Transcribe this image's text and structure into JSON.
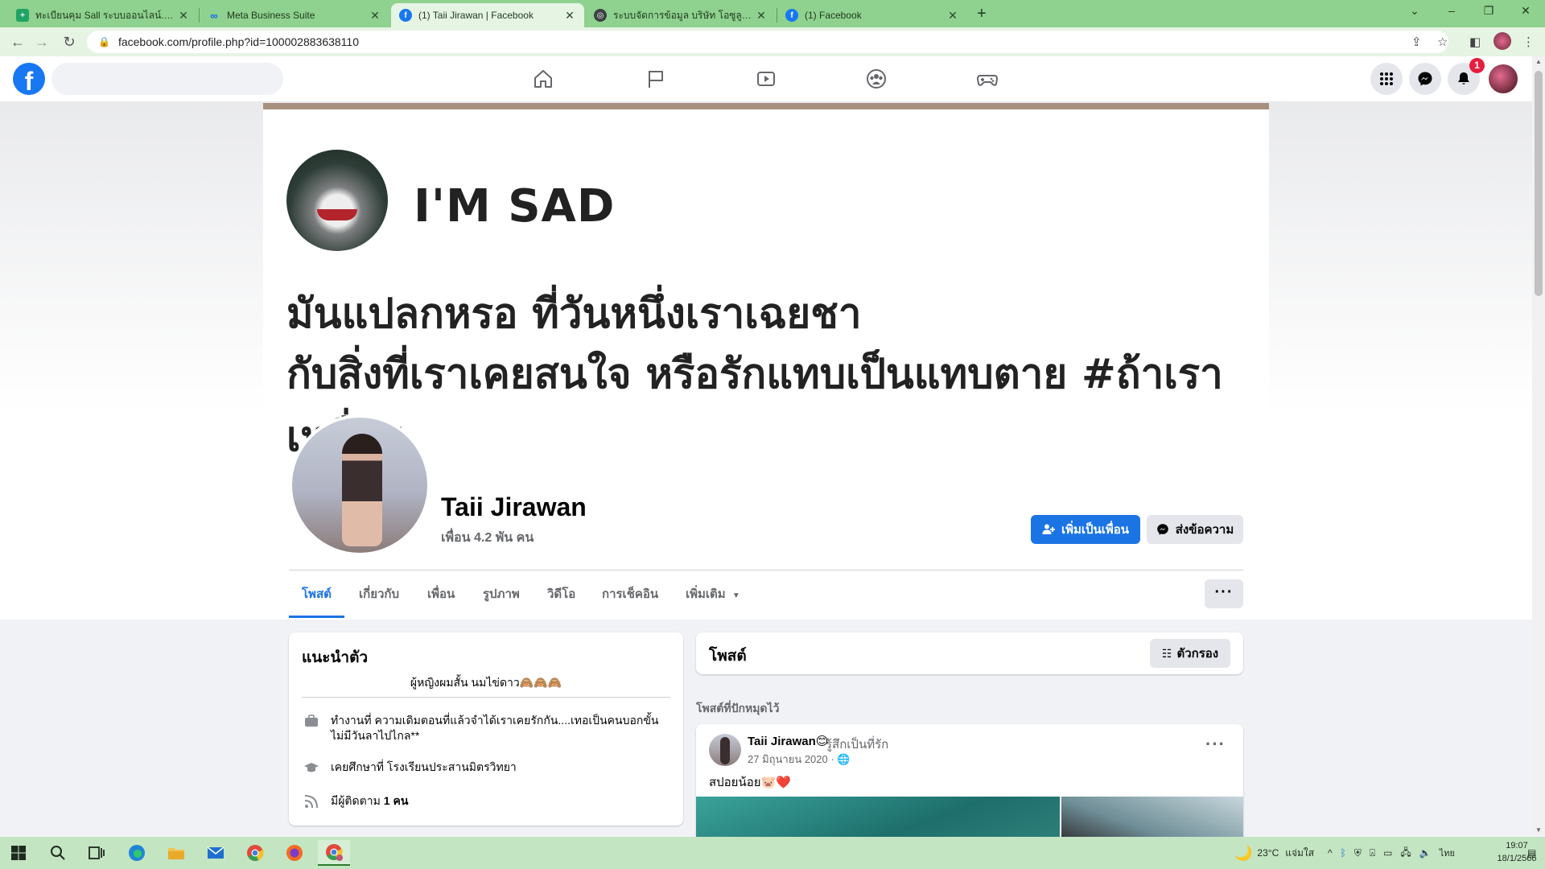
{
  "browser": {
    "tabs": [
      {
        "title": "ทะเบียนคุม Sall ระบบออนไลน์.xlsx - G",
        "favicon": "sheets-icon",
        "active": false
      },
      {
        "title": "Meta Business Suite",
        "favicon": "meta-icon",
        "active": false
      },
      {
        "title": "(1) Taii Jirawan | Facebook",
        "favicon": "facebook-icon",
        "active": true
      },
      {
        "title": "ระบบจัดการข้อมูล บริษัท โอซูลูกโอซ",
        "favicon": "globe-icon",
        "active": false
      },
      {
        "title": "(1) Facebook",
        "favicon": "facebook-icon",
        "active": false
      }
    ],
    "url": "facebook.com/profile.php?id=100002883638110"
  },
  "fbnav": {
    "logo": "f",
    "notification_count": "1"
  },
  "cover": {
    "title": "I'M SAD",
    "lines": [
      "มันแปลกหรอ ที่วันหนึ่งเราเฉยชา",
      "กับสิ่งที่เราเคยสนใจ หรือรักแทบเป็นแทบตาย #ถ้าเรา",
      "เหนื่อย"
    ]
  },
  "profile": {
    "name": "Taii Jirawan",
    "friends": "เพื่อน 4.2 พัน คน",
    "add_friend": "เพิ่มเป็นเพื่อน",
    "message": "ส่งข้อความ",
    "more": "···"
  },
  "tabs": [
    "โพสต์",
    "เกี่ยวกับ",
    "เพื่อน",
    "รูปภาพ",
    "วิดีโอ",
    "การเช็คอิน",
    "เพิ่มเติม"
  ],
  "intro": {
    "title": "แนะนำตัว",
    "bio": "ผู้หญิงผมสั้น นมไข่ดาว🙈🙈🙈",
    "rows": [
      {
        "icon": "briefcase-icon",
        "text": "ทำงานที่ ความเดิมตอนที่แล้วจำได้เราเคยรักกัน....เทอเป็นคนบอกขั้น ไม่มีวันลาไปไกล**"
      },
      {
        "icon": "graduation-cap-icon",
        "text": "เคยศึกษาที่ โรงเรียนประสานมิตรวิทยา"
      },
      {
        "icon": "rss-icon",
        "text_prefix": "มีผู้ติดตาม ",
        "text_bold": "1 คน"
      }
    ]
  },
  "posts": {
    "header": "โพสต์",
    "filter": "ตัวกรอง",
    "pinned_label": "โพสต์ที่ปักหมุดไว้",
    "pinned_post": {
      "author": "Taii Jirawan😊",
      "feeling": "รู้สึกเป็นที่รัก",
      "date": "27 มิถุนายน 2020 · 🌐",
      "text": "สปอยน้อย🐷❤️"
    }
  },
  "taskbar": {
    "weather": "23°C",
    "weather_desc": "แจ่มใส",
    "lang": "ไทย",
    "time": "19:07",
    "date": "18/1/2566"
  }
}
